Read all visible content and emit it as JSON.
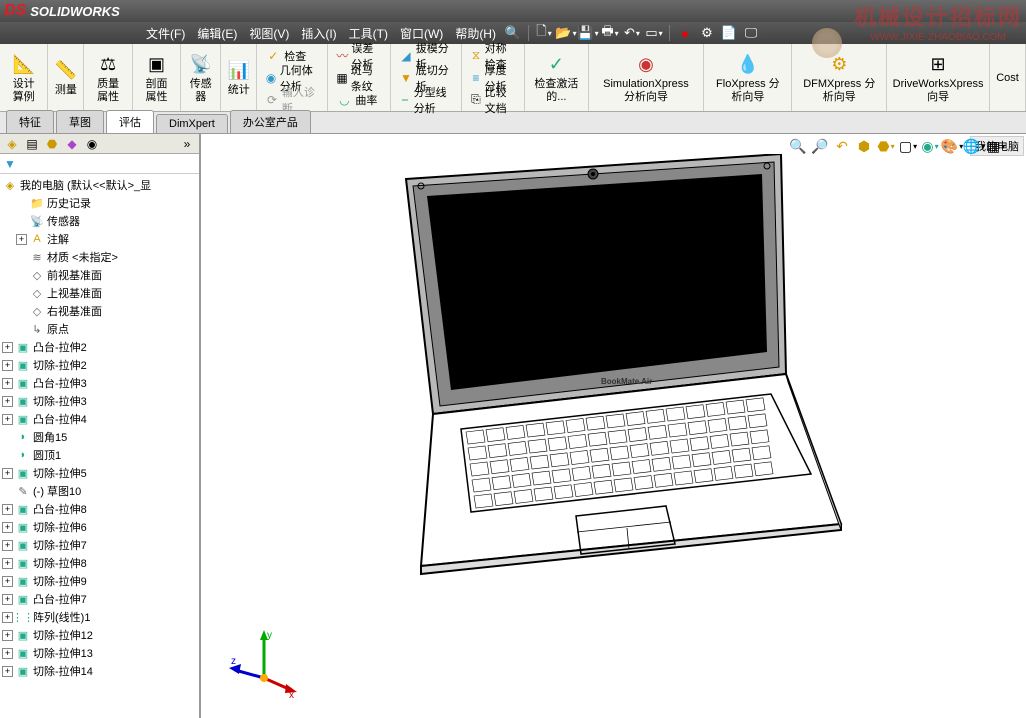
{
  "app": {
    "name": "SOLIDWORKS"
  },
  "menu": [
    "文件(F)",
    "编辑(E)",
    "视图(V)",
    "插入(I)",
    "工具(T)",
    "窗口(W)",
    "帮助(H)"
  ],
  "ribbon": {
    "big": [
      {
        "label": "设计算例",
        "icon": "📐"
      },
      {
        "label": "测量",
        "icon": "📏"
      },
      {
        "label": "质量属性",
        "icon": "⚖"
      },
      {
        "label": "剖面属性",
        "icon": "▣"
      },
      {
        "label": "传感器",
        "icon": "📡"
      },
      {
        "label": "统计",
        "icon": "📊"
      }
    ],
    "col1": [
      {
        "label": "检查",
        "icon": "✓"
      },
      {
        "label": "几何体分析",
        "icon": "◉"
      },
      {
        "label": "输入诊断",
        "icon": "⟳"
      }
    ],
    "col2": [
      {
        "label": "误差分析",
        "icon": "〰"
      },
      {
        "label": "斑马条纹",
        "icon": "▦"
      },
      {
        "label": "曲率",
        "icon": "◡"
      }
    ],
    "col3": [
      {
        "label": "拔模分析",
        "icon": "◢"
      },
      {
        "label": "底切分析",
        "icon": "▼"
      },
      {
        "label": "分型线分析",
        "icon": "⎯"
      }
    ],
    "col4": [
      {
        "label": "对称检查",
        "icon": "⧖"
      },
      {
        "label": "厚度分析",
        "icon": "≡"
      },
      {
        "label": "比较文档",
        "icon": "⎘"
      }
    ],
    "big2": [
      {
        "label": "检查激活的...",
        "icon": "✓"
      },
      {
        "label": "SimulationXpress 分析向导",
        "icon": "🔴"
      },
      {
        "label": "FloXpress 分析向导",
        "icon": "💧"
      },
      {
        "label": "DFMXpress 分析向导",
        "icon": "⚙"
      },
      {
        "label": "DriveWorksXpress 向导",
        "icon": "⊞"
      },
      {
        "label": "Cost",
        "icon": ""
      }
    ]
  },
  "tabs": [
    "特征",
    "草图",
    "评估",
    "DimXpert",
    "办公室产品"
  ],
  "active_tab": 2,
  "tree": {
    "root": "我的电脑  (默认<<默认>_显",
    "items": [
      {
        "label": "历史记录",
        "icon": "📁",
        "exp": false,
        "ind": 1
      },
      {
        "label": "传感器",
        "icon": "📡",
        "exp": false,
        "ind": 1
      },
      {
        "label": "注解",
        "icon": "A",
        "exp": true,
        "ind": 1,
        "color": "#d4a000"
      },
      {
        "label": "材质 <未指定>",
        "icon": "≋",
        "exp": false,
        "ind": 1
      },
      {
        "label": "前视基准面",
        "icon": "◇",
        "exp": false,
        "ind": 1
      },
      {
        "label": "上视基准面",
        "icon": "◇",
        "exp": false,
        "ind": 1
      },
      {
        "label": "右视基准面",
        "icon": "◇",
        "exp": false,
        "ind": 1
      },
      {
        "label": "原点",
        "icon": "↳",
        "exp": false,
        "ind": 1
      },
      {
        "label": "凸台-拉伸2",
        "icon": "▣",
        "exp": true,
        "ind": 0,
        "ficon": true
      },
      {
        "label": "切除-拉伸2",
        "icon": "▣",
        "exp": true,
        "ind": 0,
        "ficon": true
      },
      {
        "label": "凸台-拉伸3",
        "icon": "▣",
        "exp": true,
        "ind": 0,
        "ficon": true
      },
      {
        "label": "切除-拉伸3",
        "icon": "▣",
        "exp": true,
        "ind": 0,
        "ficon": true
      },
      {
        "label": "凸台-拉伸4",
        "icon": "▣",
        "exp": true,
        "ind": 0,
        "ficon": true
      },
      {
        "label": "圆角15",
        "icon": "◗",
        "exp": false,
        "ind": 0,
        "color": "#2a8"
      },
      {
        "label": "圆顶1",
        "icon": "◗",
        "exp": false,
        "ind": 0,
        "color": "#2a8"
      },
      {
        "label": "切除-拉伸5",
        "icon": "▣",
        "exp": true,
        "ind": 0,
        "ficon": true
      },
      {
        "label": "(-) 草图10",
        "icon": "✎",
        "exp": false,
        "ind": 0
      },
      {
        "label": "凸台-拉伸8",
        "icon": "▣",
        "exp": true,
        "ind": 0,
        "ficon": true
      },
      {
        "label": "切除-拉伸6",
        "icon": "▣",
        "exp": true,
        "ind": 0,
        "ficon": true
      },
      {
        "label": "切除-拉伸7",
        "icon": "▣",
        "exp": true,
        "ind": 0,
        "ficon": true
      },
      {
        "label": "切除-拉伸8",
        "icon": "▣",
        "exp": true,
        "ind": 0,
        "ficon": true
      },
      {
        "label": "切除-拉伸9",
        "icon": "▣",
        "exp": true,
        "ind": 0,
        "ficon": true
      },
      {
        "label": "凸台-拉伸7",
        "icon": "▣",
        "exp": true,
        "ind": 0,
        "ficon": true
      },
      {
        "label": "阵列(线性)1",
        "icon": "⋮⋮",
        "exp": true,
        "ind": 0,
        "color": "#2a8"
      },
      {
        "label": "切除-拉伸12",
        "icon": "▣",
        "exp": true,
        "ind": 0,
        "ficon": true
      },
      {
        "label": "切除-拉伸13",
        "icon": "▣",
        "exp": true,
        "ind": 0,
        "ficon": true
      },
      {
        "label": "切除-拉伸14",
        "icon": "▣",
        "exp": true,
        "ind": 0,
        "ficon": true
      }
    ]
  },
  "doc_tab": "我的电脑",
  "watermark": {
    "line1": "机械设计招标网",
    "line2": "WWW.JIXIE-ZHAOBIAO.COM"
  },
  "triad": {
    "x": "x",
    "y": "y",
    "z": "z"
  }
}
